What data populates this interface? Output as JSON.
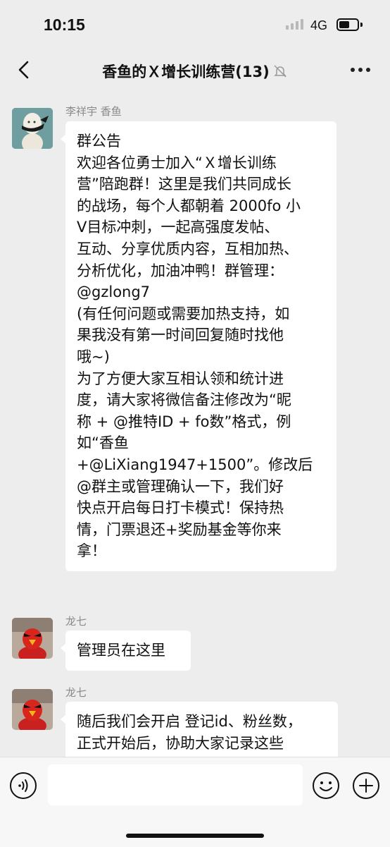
{
  "status_bar": {
    "time": "10:15",
    "network": "4G",
    "battery_level": 0.6
  },
  "header": {
    "back_icon": "chevron-left-icon",
    "title": "香鱼的Ｘ增长训练营(13)",
    "muted_icon": "bell-slash-icon",
    "more_icon": "ellipsis-icon"
  },
  "messages": [
    {
      "sender": "李祥宇 香鱼",
      "lines": [
        "群公告",
        "欢迎各位勇士加入“Ｘ增长训练",
        "营”陪跑群！这里是我们共同成长",
        "的战场，每个人都朝着 2000fo 小",
        "V目标冲刺，一起高强度发帖、",
        "互动、分享优质内容，互相加热、",
        "分析优化，加油冲鸭！群管理：",
        "@gzlong7",
        "(有任何问题或需要加热支持，如",
        "果我没有第一时间回复随时找他",
        "哦~)",
        "为了方便大家互相认领和统计进",
        "度，请大家将微信备注修改为“昵",
        "称 + @推特ID + fo数”格式，例",
        "如“香鱼",
        "+@LiXiang1947+1500”。修改后",
        "@群主或管理确认一下，我们好",
        "快点开启每日打卡模式！保持热",
        "情，门票退还+奖励基金等你来",
        "拿！"
      ]
    },
    {
      "sender": "龙七",
      "lines": [
        "管理员在这里"
      ]
    },
    {
      "sender": "龙七",
      "lines": [
        "随后我们会开启 登记id、粉丝数，",
        "正式开始后，协助大家记录这些"
      ]
    }
  ],
  "input_bar": {
    "voice_icon": "voice-icon",
    "input_value": "",
    "emoji_icon": "emoji-icon",
    "plus_icon": "plus-circle-icon"
  }
}
